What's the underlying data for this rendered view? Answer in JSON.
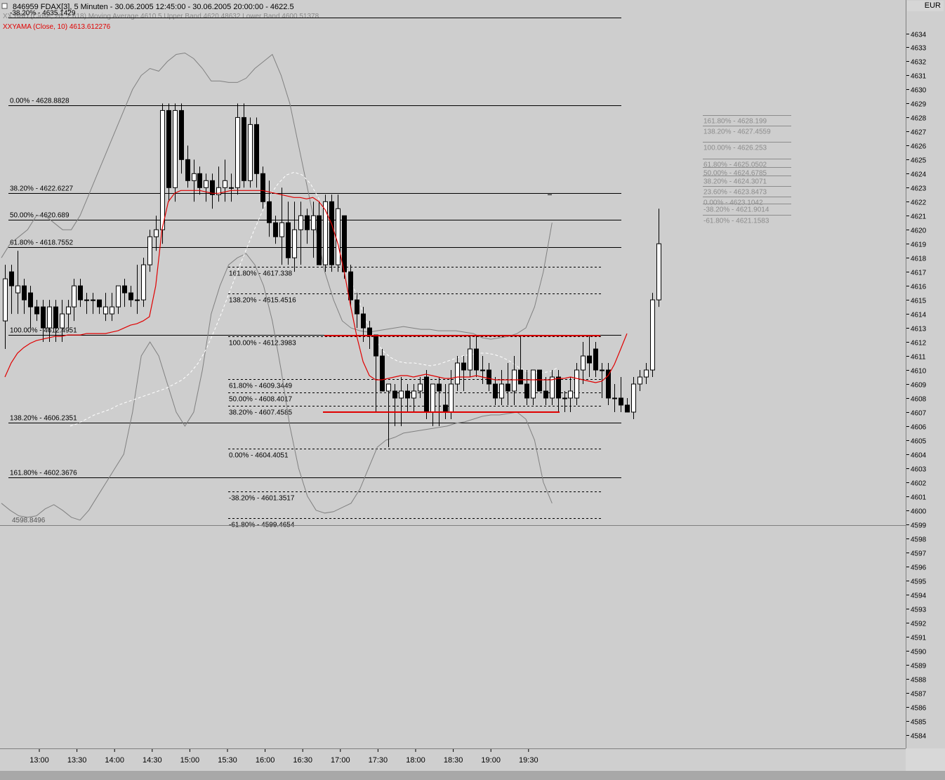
{
  "header": {
    "title": "846959  FDAX[3], 5 Minuten - 30.06.2005 12:45:00 - 30.06.2005 20:00:00 - 4622.5",
    "indicator_bbd": "XX.BBD (Close, 20, 2.618) Moving Average  4610.5  Upper Band 4620.48632  Lower Band 4600.51378",
    "indicator_ama": "XXYAMA (Close, 10) 4613.612276",
    "currency": "EUR"
  },
  "chart_data": {
    "type": "candlestick",
    "x_ticks": [
      "13:00",
      "13:30",
      "14:00",
      "14:30",
      "15:00",
      "15:30",
      "16:00",
      "16:30",
      "17:00",
      "17:30",
      "18:00",
      "18:30",
      "19:00",
      "19:30"
    ],
    "ylim": [
      4583.4,
      4636.2
    ],
    "y_ticks": [
      4634,
      4633,
      4632,
      4631,
      4630,
      4629,
      4628,
      4627,
      4626,
      4625,
      4624,
      4623,
      4622,
      4621,
      4620,
      4619,
      4618,
      4617,
      4616,
      4615,
      4614,
      4613,
      4612,
      4611,
      4610,
      4609,
      4608,
      4607,
      4606,
      4605,
      4604,
      4603,
      4602,
      4601,
      4600,
      4599,
      4598,
      4597,
      4596,
      4595,
      4594,
      4593,
      4592,
      4591,
      4590,
      4589,
      4588,
      4587,
      4586,
      4585,
      4584
    ],
    "candles": [
      [
        4613.5,
        4617.5,
        4611.5,
        4616.5
      ],
      [
        4617,
        4617.5,
        4614,
        4616
      ],
      [
        4615.5,
        4618.5,
        4614,
        4616
      ],
      [
        4616,
        4616.5,
        4614,
        4615
      ],
      [
        4615.5,
        4616,
        4613,
        4614.5
      ],
      [
        4614.5,
        4615,
        4613.5,
        4614
      ],
      [
        4614.5,
        4615,
        4612,
        4613
      ],
      [
        4613,
        4615,
        4612,
        4614.5
      ],
      [
        4614.5,
        4615,
        4612,
        4613
      ],
      [
        4613,
        4615,
        4612,
        4614
      ],
      [
        4614,
        4615,
        4613,
        4614.5
      ],
      [
        4614.5,
        4616.5,
        4613.5,
        4616
      ],
      [
        4616,
        4616.5,
        4614.5,
        4615
      ],
      [
        4615,
        4615.5,
        4614,
        4615
      ],
      [
        4615,
        4615.5,
        4614,
        4615
      ],
      [
        4615,
        4615,
        4614,
        4614.5
      ],
      [
        4614,
        4615.5,
        4613.5,
        4614.5
      ],
      [
        4614,
        4615.5,
        4613.5,
        4614.5
      ],
      [
        4614.5,
        4616,
        4614,
        4616
      ],
      [
        4616,
        4616.5,
        4614.5,
        4615.5
      ],
      [
        4615.5,
        4616,
        4614.5,
        4615
      ],
      [
        4615,
        4617.5,
        4614,
        4615
      ],
      [
        4615,
        4618,
        4614.5,
        4617.5
      ],
      [
        4617.5,
        4620,
        4617,
        4619.5
      ],
      [
        4619.5,
        4621,
        4618.5,
        4620
      ],
      [
        4620,
        4629,
        4619,
        4628.5
      ],
      [
        4628.5,
        4629,
        4622,
        4623
      ],
      [
        4623,
        4629,
        4622,
        4628.5
      ],
      [
        4628.5,
        4629,
        4624,
        4625
      ],
      [
        4625,
        4626,
        4623,
        4623.5
      ],
      [
        4623.5,
        4625,
        4622,
        4624
      ],
      [
        4624,
        4624.5,
        4622.5,
        4623
      ],
      [
        4623,
        4624,
        4622,
        4623.5
      ],
      [
        4623.5,
        4624,
        4621.5,
        4622.5
      ],
      [
        4622.5,
        4624.5,
        4622,
        4623
      ],
      [
        4623,
        4625,
        4622,
        4623.5
      ],
      [
        4623,
        4624,
        4622,
        4623
      ],
      [
        4623,
        4629,
        4622.5,
        4628
      ],
      [
        4628,
        4629,
        4623,
        4623.5
      ],
      [
        4623.5,
        4628,
        4623,
        4627.5
      ],
      [
        4627.5,
        4628,
        4623,
        4624
      ],
      [
        4624,
        4624.5,
        4621.5,
        4622
      ],
      [
        4622,
        4623.5,
        4619.5,
        4620.5
      ],
      [
        4620.5,
        4621,
        4619,
        4619.5
      ],
      [
        4619.5,
        4623,
        4617.5,
        4620.5
      ],
      [
        4620.5,
        4622,
        4617.5,
        4618
      ],
      [
        4618,
        4622,
        4617,
        4620
      ],
      [
        4620,
        4622,
        4617.5,
        4621
      ],
      [
        4621,
        4621.5,
        4619,
        4620
      ],
      [
        4620,
        4622,
        4618,
        4621
      ],
      [
        4621,
        4622,
        4617.5,
        4617.5
      ],
      [
        4617.5,
        4622.5,
        4617,
        4622
      ],
      [
        4622,
        4622.5,
        4617,
        4617.5
      ],
      [
        4617.5,
        4622.5,
        4617,
        4621.5
      ],
      [
        4621,
        4621,
        4616.5,
        4617
      ],
      [
        4617,
        4617.5,
        4614.5,
        4615
      ],
      [
        4615,
        4615.5,
        4613,
        4614
      ],
      [
        4614,
        4614.5,
        4612,
        4613
      ],
      [
        4613,
        4613.5,
        4611.5,
        4612.5
      ],
      [
        4612.5,
        4612.5,
        4607,
        4611
      ],
      [
        4611,
        4611.5,
        4608.5,
        4608.5
      ],
      [
        4608.5,
        4609,
        4604.5,
        4609
      ],
      [
        4608.5,
        4609,
        4606,
        4608
      ],
      [
        4608,
        4609.5,
        4606,
        4608.5
      ],
      [
        4608.5,
        4609,
        4607,
        4608
      ],
      [
        4608,
        4609,
        4607,
        4608.5
      ],
      [
        4608.5,
        4609.5,
        4608,
        4609
      ],
      [
        4609.5,
        4610,
        4606.5,
        4607
      ],
      [
        4607,
        4609,
        4606,
        4609
      ],
      [
        4609,
        4609.5,
        4606,
        4608.5
      ],
      [
        4607.5,
        4609,
        4606.5,
        4607
      ],
      [
        4607,
        4610,
        4606.5,
        4609
      ],
      [
        4609,
        4611,
        4608.5,
        4610.5
      ],
      [
        4610.5,
        4611,
        4608.5,
        4610
      ],
      [
        4610,
        4612.5,
        4609.5,
        4611.5
      ],
      [
        4611.5,
        4612.5,
        4609.5,
        4610
      ],
      [
        4610,
        4611,
        4609,
        4610
      ],
      [
        4610,
        4610.5,
        4608.5,
        4609
      ],
      [
        4609,
        4609.5,
        4607.5,
        4608
      ],
      [
        4608,
        4610,
        4607.5,
        4609
      ],
      [
        4609,
        4610.5,
        4607.5,
        4608.5
      ],
      [
        4608.5,
        4611,
        4607.5,
        4610
      ],
      [
        4610,
        4612.5,
        4609,
        4609
      ],
      [
        4609,
        4610,
        4607.5,
        4608
      ],
      [
        4608,
        4610,
        4607.5,
        4610
      ],
      [
        4610,
        4610,
        4608.5,
        4608.5
      ],
      [
        4608.5,
        4609.5,
        4607.5,
        4608
      ],
      [
        4608,
        4610,
        4607.5,
        4609.5
      ],
      [
        4609.5,
        4610,
        4607,
        4608
      ],
      [
        4608,
        4608.5,
        4607,
        4608
      ],
      [
        4608,
        4609.5,
        4607,
        4608.5
      ],
      [
        4608,
        4610.5,
        4607.5,
        4610
      ],
      [
        4610,
        4612,
        4609,
        4611
      ],
      [
        4611,
        4612.5,
        4609.5,
        4610.5
      ],
      [
        4611.5,
        4612,
        4609.5,
        4610
      ],
      [
        4610,
        4610.5,
        4608,
        4610
      ],
      [
        4610,
        4610.5,
        4607.5,
        4608
      ],
      [
        4608,
        4609,
        4607,
        4608
      ],
      [
        4608,
        4609.5,
        4607,
        4607.5
      ],
      [
        4607.5,
        4608,
        4607,
        4607
      ],
      [
        4607,
        4609.5,
        4606.5,
        4609
      ],
      [
        4609,
        4610,
        4608.5,
        4609.5
      ],
      [
        4609.5,
        4610.5,
        4609,
        4610
      ],
      [
        4610,
        4615.5,
        4609.5,
        4615
      ],
      [
        4615,
        4621.5,
        4614.5,
        4619
      ]
    ],
    "moving_average": [
      4606,
      4606.2,
      4606.5,
      4606.8,
      4607,
      4607.2,
      4607.5,
      4607.7,
      4607.9,
      4608.1,
      4608.3,
      4608.5,
      4608.7,
      4609,
      4609.3,
      4609.8,
      4610.5,
      4611.5,
      4612.8,
      4614.2,
      4615.7,
      4617.2,
      4618.6,
      4620,
      4621.3,
      4622.5,
      4623.3,
      4623.9,
      4624.1,
      4623.9,
      4623.3,
      4622.3,
      4621,
      4619.5,
      4618,
      4616.5,
      4615,
      4613.5,
      4612.3,
      4611.4,
      4610.9,
      4610.6,
      4610.5,
      4610.5,
      4610.4,
      4610.3,
      4610.4,
      4610.6,
      4610.8,
      4611,
      4611.1,
      4611.2,
      4611.2,
      4611.1,
      4610.9,
      4610.6,
      4610.2,
      4609.9,
      4609.8,
      4609.8,
      4609.9,
      4610.2
    ],
    "upper_band": [
      4618,
      4619,
      4619.5,
      4620,
      4621,
      4621,
      4620.5,
      4620,
      4620,
      4621,
      4622.5,
      4624,
      4625.5,
      4627,
      4628.5,
      4630,
      4631,
      4631.5,
      4631.3,
      4632,
      4632.5,
      4632.6,
      4632.2,
      4631.5,
      4630.6,
      4630.6,
      4630.5,
      4630.5,
      4630.8,
      4631.5,
      4632,
      4632.5,
      4631,
      4629,
      4626,
      4623,
      4620,
      4617,
      4615,
      4613.5,
      4613,
      4612.8,
      4612.7,
      4612.8,
      4612.9,
      4613,
      4613.1,
      4613,
      4612.9,
      4612.9,
      4612.8,
      4612.8,
      4612.8,
      4612.7,
      4612.6,
      4612.3,
      4612.2,
      4612.3,
      4612.4,
      4612.6,
      4613,
      4614.5,
      4617,
      4620.5
    ],
    "lower_band": [
      4600.5,
      4600,
      4599.6,
      4599.5,
      4599.6,
      4600.1,
      4600.4,
      4600,
      4599.5,
      4599.3,
      4600,
      4601,
      4602,
      4603,
      4604,
      4607,
      4611,
      4612,
      4611,
      4609,
      4607,
      4606,
      4607,
      4610,
      4614,
      4616,
      4617.5,
      4618,
      4618.3,
      4617.5,
      4616,
      4613.5,
      4610,
      4606,
      4603,
      4601,
      4600,
      4599.8,
      4599.9,
      4600.2,
      4600.5,
      4601.5,
      4603,
      4604.5,
      4605,
      4605.2,
      4605.5,
      4605.6,
      4605.7,
      4605.8,
      4605.9,
      4606,
      4606.2,
      4606.3,
      4606.5,
      4606.7,
      4606.8,
      4606.8,
      4606.9,
      4607,
      4606.5,
      4605,
      4602,
      4600.5
    ],
    "ama": [
      4609.5,
      4610.5,
      4611.2,
      4611.6,
      4611.9,
      4612.1,
      4612.2,
      4612.3,
      4612.4,
      4612.4,
      4612.5,
      4612.5,
      4612.5,
      4612.6,
      4612.6,
      4612.6,
      4612.6,
      4612.7,
      4612.8,
      4613.0,
      4613.2,
      4613.3,
      4613.5,
      4613.8,
      4616.0,
      4620.0,
      4622.0,
      4622.6,
      4622.8,
      4622.8,
      4622.8,
      4622.8,
      4622.7,
      4622.6,
      4622.6,
      4622.7,
      4622.8,
      4622.8,
      4622.8,
      4622.8,
      4622.8,
      4622.8,
      4622.7,
      4622.6,
      4622.5,
      4622.4,
      4622.3,
      4622.3,
      4622.2,
      4622.3,
      4622.0,
      4621.4,
      4620.4,
      4619.0,
      4617.0,
      4614.6,
      4612.4,
      4610.6,
      4609.6,
      4609.3,
      4609.3,
      4609.4,
      4609.5,
      4609.6,
      4609.6,
      4609.5,
      4609.6,
      4609.7,
      4609.6,
      4609.5,
      4609.4,
      4609.4,
      4609.5,
      4609.5,
      4609.5,
      4609.6,
      4609.5,
      4609.4,
      4609.3,
      4609.3,
      4609.3,
      4609.3,
      4609.3,
      4609.3,
      4609.3,
      4609.3,
      4609.3,
      4609.3,
      4609.4,
      4609.4,
      4609.5,
      4609.4,
      4609.3,
      4609.2,
      4609.1,
      4609.2,
      4609.6,
      4610.4,
      4611.5,
      4612.6
    ],
    "fib_left": {
      "levels": [
        {
          "label": "-38.20% - 4635.1429",
          "price": 4635.1429
        },
        {
          "label": "0.00% - 4628.8828",
          "price": 4628.8828
        },
        {
          "label": "38.20% - 4622.6227",
          "price": 4622.6227
        },
        {
          "label": "50.00% - 4620.689",
          "price": 4620.689
        },
        {
          "label": "61.80% - 4618.7552",
          "price": 4618.7552
        },
        {
          "label": "100.00% - 4612.4951",
          "price": 4612.4951
        },
        {
          "label": "138.20% - 4606.2351",
          "price": 4606.2351
        },
        {
          "label": "161.80% - 4602.3676",
          "price": 4602.3676
        }
      ],
      "bottom_label": "4598.8496"
    },
    "fib_mid": [
      {
        "label": "161.80% - 4617.338",
        "price": 4617.338
      },
      {
        "label": "138.20% - 4615.4516",
        "price": 4615.4516
      },
      {
        "label": "100.00% - 4612.3983",
        "price": 4612.3983
      },
      {
        "label": "61.80% - 4609.3449",
        "price": 4609.3449
      },
      {
        "label": "50.00% - 4608.4017",
        "price": 4608.4017
      },
      {
        "label": "38.20% - 4607.4585",
        "price": 4607.4585
      },
      {
        "label": "0.00% - 4604.4051",
        "price": 4604.4051
      },
      {
        "label": "-38.20% - 4601.3517",
        "price": 4601.3517
      },
      {
        "label": "-61.80% - 4599.4654",
        "price": 4599.4654
      }
    ],
    "fib_right": [
      {
        "label": "161.80% - 4628.199",
        "price": 4628.199
      },
      {
        "label": "138.20% - 4627.4559",
        "price": 4627.4559
      },
      {
        "label": "100.00% - 4626.253",
        "price": 4626.253
      },
      {
        "label": "61.80% - 4625.0502",
        "price": 4625.0502
      },
      {
        "label": "50.00% - 4624.6785",
        "price": 4624.6785
      },
      {
        "label": "38.20% - 4624.3071",
        "price": 4624.3071
      },
      {
        "label": "23.60% - 4623.8473",
        "price": 4623.8473
      },
      {
        "label": "0.00% - 4623.1042",
        "price": 4623.1042
      },
      {
        "label": "-38.20% - 4621.9014",
        "price": 4621.9014
      },
      {
        "label": "-61.80% - 4621.1583",
        "price": 4621.1583
      }
    ],
    "range_lines": [
      4612.45,
      4607.0
    ],
    "last_price_marker": 4622.5
  }
}
